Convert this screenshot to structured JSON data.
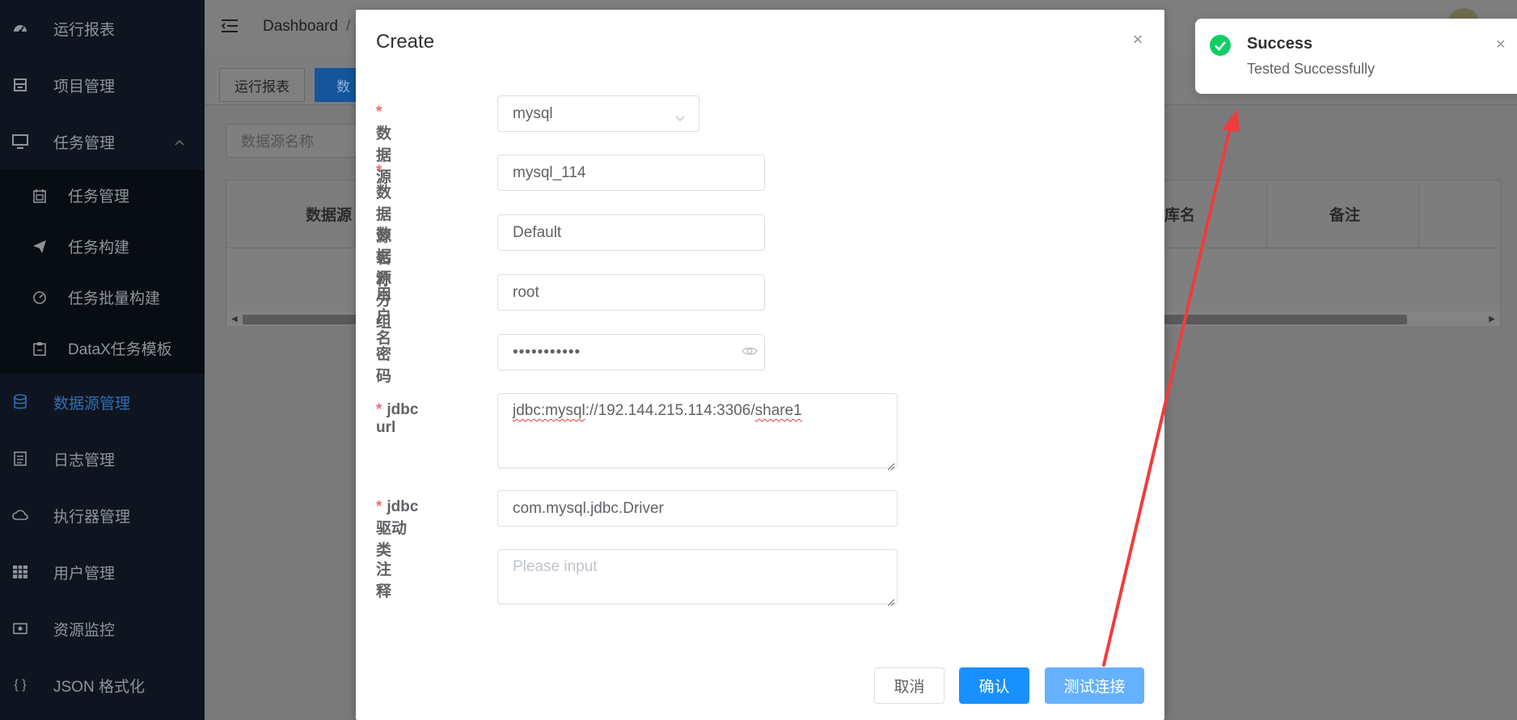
{
  "sidebar": {
    "items": [
      {
        "label": "运行报表",
        "icon": "dashboard-icon"
      },
      {
        "label": "项目管理",
        "icon": "project-icon"
      },
      {
        "label": "任务管理",
        "icon": "monitor-icon",
        "expanded": true,
        "children": [
          {
            "label": "任务管理",
            "icon": "calendar-icon"
          },
          {
            "label": "任务构建",
            "icon": "paper-plane-icon"
          },
          {
            "label": "任务批量构建",
            "icon": "gauge-icon"
          },
          {
            "label": "DataX任务模板",
            "icon": "clipboard-icon"
          }
        ]
      },
      {
        "label": "数据源管理",
        "icon": "database-icon",
        "active": true
      },
      {
        "label": "日志管理",
        "icon": "document-icon"
      },
      {
        "label": "执行器管理",
        "icon": "cloud-icon"
      },
      {
        "label": "用户管理",
        "icon": "grid-icon"
      },
      {
        "label": "资源监控",
        "icon": "resource-icon"
      },
      {
        "label": "JSON 格式化",
        "icon": "braces-icon"
      }
    ]
  },
  "header": {
    "breadcrumb": [
      "Dashboard",
      "/"
    ]
  },
  "tabs": [
    {
      "label": "运行报表"
    },
    {
      "label": "数",
      "active": true
    }
  ],
  "page": {
    "search_placeholder": "数据源名称",
    "table_headers": [
      "数据源",
      "库名",
      "备注"
    ]
  },
  "dialog": {
    "title": "Create",
    "fields": {
      "datasource": {
        "label": "数据源",
        "value": "mysql",
        "required": true
      },
      "datasource_name": {
        "label": "数据源名称",
        "value": "mysql_114",
        "required": true
      },
      "datasource_group": {
        "label": "数据源分组",
        "value": "Default",
        "required": false
      },
      "username": {
        "label": "用户名",
        "value": "root",
        "required": false
      },
      "password": {
        "label": "密码",
        "value": "•••••••••••",
        "required": false
      },
      "jdbc_url": {
        "label": "jdbc url",
        "value_prefix": "jdbc:mysql",
        "value_middle": "://192.144.215.114:3306/",
        "value_suffix": "share1",
        "required": true
      },
      "jdbc_driver": {
        "label": "jdbc驱动类",
        "value": "com.mysql.jdbc.Driver",
        "required": true
      },
      "comment": {
        "label": "注释",
        "placeholder": "Please input",
        "required": false
      }
    },
    "buttons": {
      "cancel": "取消",
      "confirm": "确认",
      "test": "测试连接"
    }
  },
  "toast": {
    "title": "Success",
    "message": "Tested Successfully",
    "color": "#13ce66"
  },
  "colors": {
    "primary": "#1890ff",
    "sidebar_bg": "#0f1520",
    "active_menu": "#2f6fb3",
    "required": "#f56c6c",
    "annotation_arrow": "#f03c3c"
  }
}
